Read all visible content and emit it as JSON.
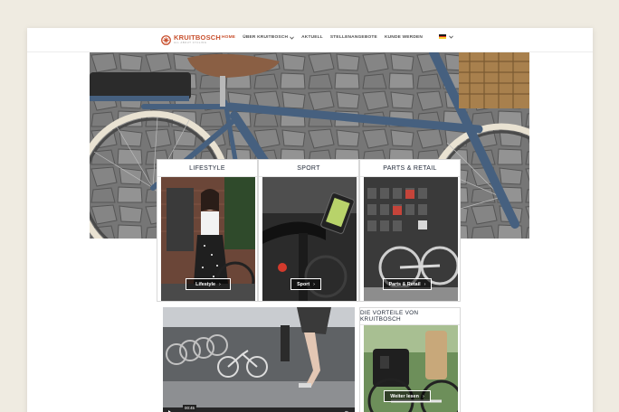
{
  "header": {
    "logo_name": "KRUITBOSCH",
    "logo_tagline": "ALL ABOUT CYCLING",
    "nav": [
      {
        "label": "HOME",
        "active": true
      },
      {
        "label": "ÜBER KRUITBOSCH",
        "has_dropdown": true
      },
      {
        "label": "AKTUELL"
      },
      {
        "label": "STELLENANGEBOTE"
      },
      {
        "label": "KUNDE WERDEN"
      }
    ],
    "language": {
      "flag": "german-flag-icon",
      "selected": "DE"
    }
  },
  "cards": [
    {
      "title": "LIFESTYLE",
      "button": "Lifestyle"
    },
    {
      "title": "SPORT",
      "button": "Sport"
    },
    {
      "title": "PARTS & RETAIL",
      "button": "Parts & Retail"
    }
  ],
  "video": {
    "timestamp": "00:45"
  },
  "advantages": {
    "title": "DIE VORTEILE VON KRUITBOSCH",
    "button": "Weiter lesen"
  },
  "colors": {
    "accent": "#c8502e",
    "background": "#efebe1",
    "bike_blue": "#46607f"
  }
}
